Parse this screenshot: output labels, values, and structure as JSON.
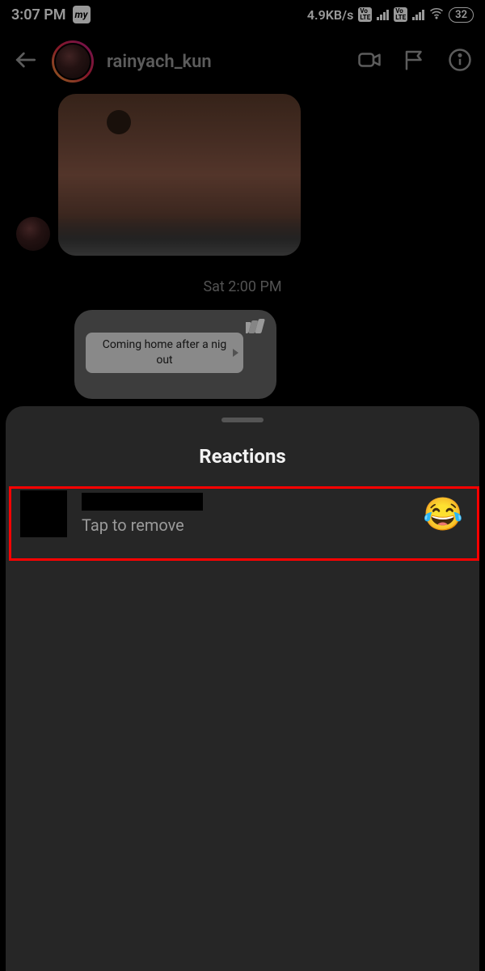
{
  "statusBar": {
    "time": "3:07 PM",
    "myLabel": "my",
    "dataRate": "4.9KB/s",
    "volte": "Vo\nLTE",
    "battery": "32"
  },
  "header": {
    "username": "rainyach_kun"
  },
  "chat": {
    "timestamp": "Sat 2:00 PM",
    "reelCaption": "Coming home after a nig\nout"
  },
  "sheet": {
    "title": "Reactions",
    "tapToRemove": "Tap to remove",
    "emoji": "😂"
  }
}
